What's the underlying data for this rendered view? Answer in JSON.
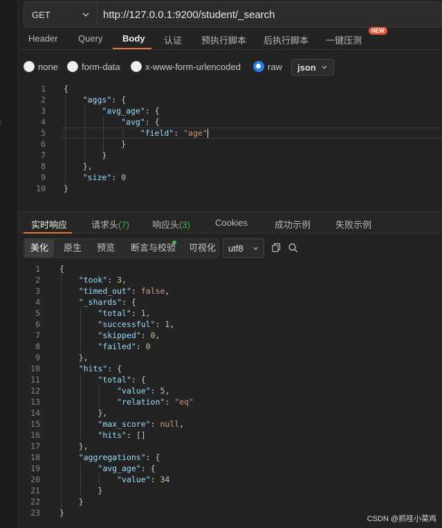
{
  "request": {
    "method": "GET",
    "url": "http://127.0.0.1:9200/student/_search"
  },
  "request_tabs": [
    "Header",
    "Query",
    "Body",
    "认证",
    "预执行脚本",
    "后执行脚本",
    "一键压测"
  ],
  "active_request_tab": "Body",
  "new_badge": "NEW",
  "body_types": [
    "none",
    "form-data",
    "x-www-form-urlencoded",
    "raw"
  ],
  "selected_body_type": "raw",
  "body_format": "json",
  "request_body": {
    "line_numbers": [
      "1",
      "2",
      "3",
      "4",
      "5",
      "6",
      "7",
      "8",
      "9",
      "10"
    ],
    "lines": [
      "{",
      "    \"aggs\": {",
      "        \"avg_age\": {",
      "            \"avg\": {",
      "                \"field\": \"age\"",
      "            }",
      "        }",
      "    },",
      "    \"size\": 0",
      "}"
    ]
  },
  "response_tabs": {
    "realtime": "实时响应",
    "request_headers": "请求头",
    "request_headers_count": "(7)",
    "response_headers": "响应头",
    "response_headers_count": "(3)",
    "cookies": "Cookies",
    "success_example": "成功示例",
    "fail_example": "失败示例"
  },
  "view_modes": [
    "美化",
    "原生",
    "预览",
    "断言与校验",
    "可视化"
  ],
  "active_view_mode": "美化",
  "encoding": "utf8",
  "response_body": {
    "line_numbers": [
      "1",
      "2",
      "3",
      "4",
      "5",
      "6",
      "7",
      "8",
      "9",
      "10",
      "11",
      "12",
      "13",
      "14",
      "15",
      "16",
      "17",
      "18",
      "19",
      "20",
      "21",
      "22",
      "23"
    ],
    "lines": [
      "{",
      "    \"took\": 3,",
      "    \"timed_out\": false,",
      "    \"_shards\": {",
      "        \"total\": 1,",
      "        \"successful\": 1,",
      "        \"skipped\": 0,",
      "        \"failed\": 0",
      "    },",
      "    \"hits\": {",
      "        \"total\": {",
      "            \"value\": 5,",
      "            \"relation\": \"eq\"",
      "        },",
      "        \"max_score\": null,",
      "        \"hits\": []",
      "    },",
      "    \"aggregations\": {",
      "        \"avg_age\": {",
      "            \"value\": 34",
      "        }",
      "    }",
      "}"
    ]
  },
  "watermark": "CSDN @抓哇小菜鸡",
  "colors": {
    "accent": "#e8743b",
    "key": "#9cdcfe",
    "string": "#ce9178",
    "number": "#b5cea8",
    "radio_selected": "#2a7de1",
    "count_green": "#4caf50"
  }
}
